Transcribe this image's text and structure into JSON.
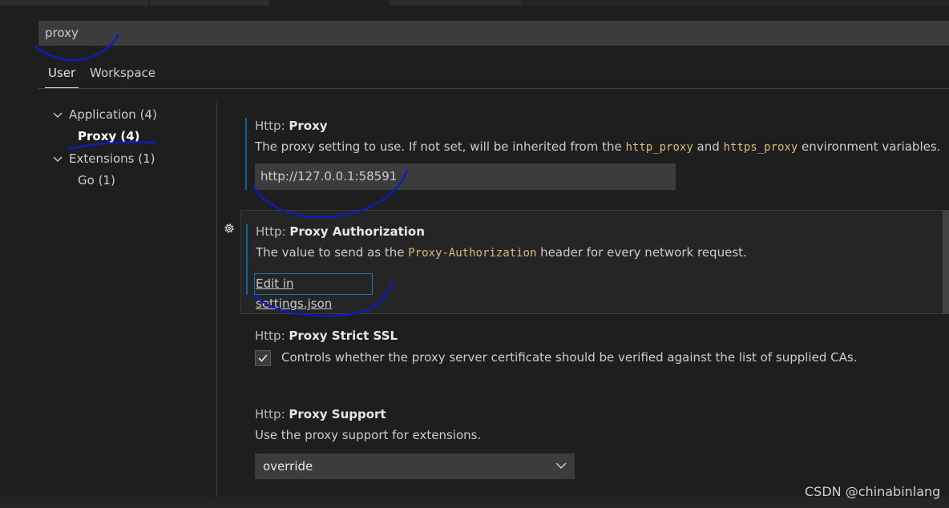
{
  "search": {
    "value": "proxy"
  },
  "scope_tabs": {
    "user": "User",
    "workspace": "Workspace"
  },
  "toc": {
    "application": "Application (4)",
    "proxy": "Proxy (4)",
    "extensions": "Extensions (1)",
    "go": "Go (1)"
  },
  "settings": {
    "proxy": {
      "category": "Http: ",
      "name": "Proxy",
      "desc_pre": "The proxy setting to use. If not set, will be inherited from the ",
      "code1": "http_proxy",
      "desc_mid": " and ",
      "code2": "https_proxy",
      "desc_post": " environment variables.",
      "value": "http://127.0.0.1:58591"
    },
    "proxy_auth": {
      "category": "Http: ",
      "name": "Proxy Authorization",
      "desc_pre": "The value to send as the ",
      "code": "Proxy-Authorization",
      "desc_post": " header for every network request.",
      "link": "Edit in settings.json"
    },
    "strict_ssl": {
      "category": "Http: ",
      "name": "Proxy Strict SSL",
      "desc": "Controls whether the proxy server certificate should be verified against the list of supplied CAs.",
      "checked": true
    },
    "support": {
      "category": "Http: ",
      "name": "Proxy Support",
      "desc": "Use the proxy support for extensions.",
      "value": "override"
    }
  },
  "watermark": "CSDN @chinabinlang",
  "colors": {
    "accent": "#0e639c",
    "annotation": "#0a1cc8",
    "code": "#d7ba7d"
  }
}
